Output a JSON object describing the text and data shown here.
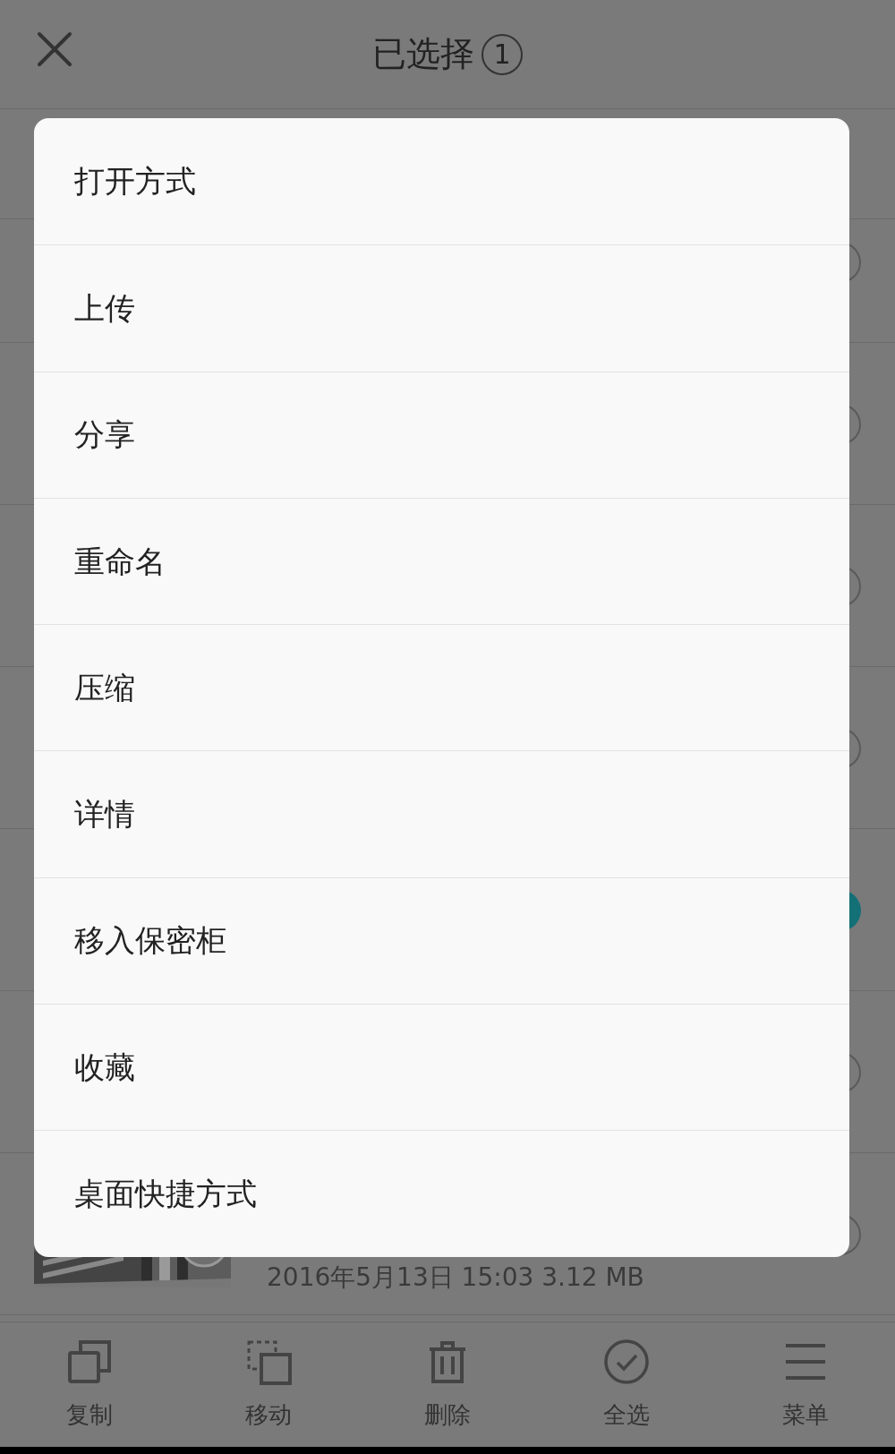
{
  "header": {
    "title": "已选择",
    "count": "1"
  },
  "files": [
    {
      "selected": false
    },
    {
      "selected": false
    },
    {
      "selected": false
    },
    {
      "selected": false
    },
    {
      "selected": true
    },
    {
      "selected": false
    },
    {
      "selected": false,
      "meta": "2016年5月13日 15:03 3.12 MB"
    }
  ],
  "menu": {
    "items": [
      {
        "label": "打开方式"
      },
      {
        "label": "上传"
      },
      {
        "label": "分享"
      },
      {
        "label": "重命名"
      },
      {
        "label": "压缩"
      },
      {
        "label": "详情"
      },
      {
        "label": "移入保密柜"
      },
      {
        "label": "收藏"
      },
      {
        "label": "桌面快捷方式"
      }
    ]
  },
  "toolbar": [
    {
      "kind": "copy",
      "label": "复制"
    },
    {
      "kind": "move",
      "label": "移动"
    },
    {
      "kind": "delete",
      "label": "删除"
    },
    {
      "kind": "select_all",
      "label": "全选"
    },
    {
      "kind": "menu",
      "label": "菜单"
    }
  ]
}
